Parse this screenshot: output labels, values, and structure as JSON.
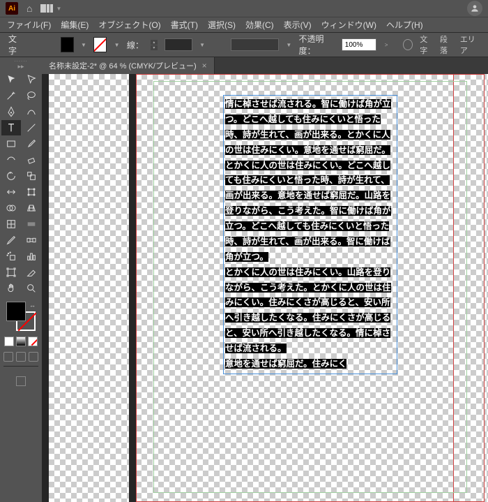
{
  "titlebar": {
    "logo": "Ai"
  },
  "menu": {
    "file": "ファイル(F)",
    "edit": "編集(E)",
    "object": "オブジェクト(O)",
    "format": "書式(T)",
    "select": "選択(S)",
    "effect": "効果(C)",
    "view": "表示(V)",
    "window": "ウィンドウ(W)",
    "help": "ヘルプ(H)"
  },
  "ctrl": {
    "tool": "文字",
    "stroke_label": "線：",
    "stroke_width": "",
    "opacity_label": "不透明度：",
    "opacity": "100%",
    "r1": "文字",
    "r2": "段落",
    "r3": "エリア"
  },
  "doc": {
    "tab": "名称未設定-2* @ 64 % (CMYK/プレビュー)"
  },
  "text": {
    "p1": "情に棹させば流される。智に働けば角が立つ。どこへ越しても住みにくいと悟った時、詩が生れて、画が出来る。とかくに人の世は住みにくい。意地を通せば窮屈だ。",
    "p2": "とかくに人の世は住みにくい。どこへ越しても住みにくいと悟った時、詩が生れて、画が出来る。意地を通せば窮屈だ。山路を登りながら、こう考えた。智に働けば角が立つ。どこへ越しても住みにくいと悟った時、詩が生れて、画が出来る。智に働けば角が立つ。",
    "p3": "とかくに人の世は住みにくい。山路を登りながら、こう考えた。とかくに人の世は住みにくい。住みにくさが高じると、安い所へ引き越したくなる。住みにくさが高じると、安い所へ引き越したくなる。情に棹させば流される。",
    "p4": "意地を通せば窮屈だ。住みにく"
  }
}
